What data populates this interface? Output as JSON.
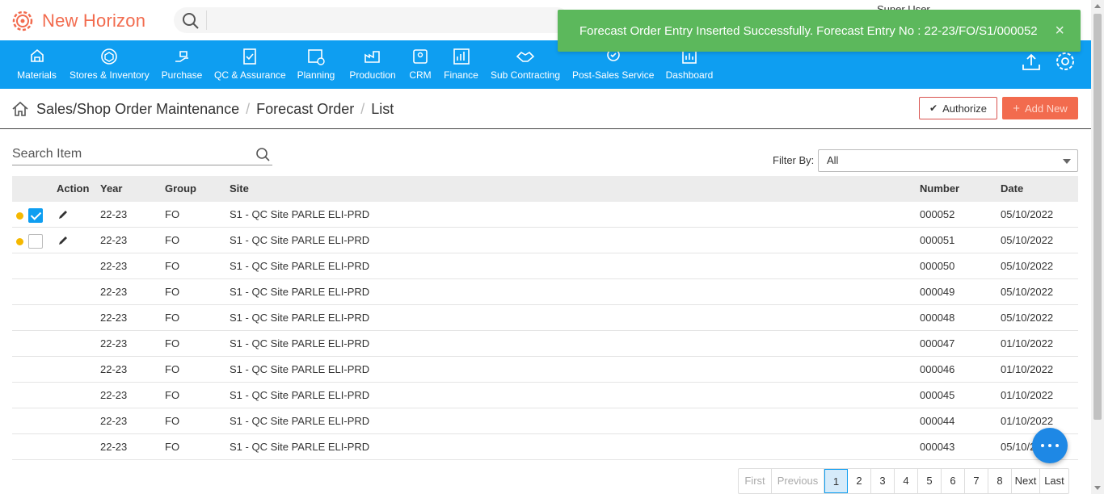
{
  "app": {
    "title": "New Horizon",
    "user": "Super User"
  },
  "topbar": {
    "search_placeholder": ""
  },
  "toast": {
    "message": "Forecast Order Entry Inserted Successfully. Forecast Entry No : 22-23/FO/S1/000052",
    "close": "×"
  },
  "nav": {
    "items": [
      {
        "label": "Materials",
        "icon": "materials-icon"
      },
      {
        "label": "Stores & Inventory",
        "icon": "stores-icon"
      },
      {
        "label": "Purchase",
        "icon": "purchase-icon"
      },
      {
        "label": "QC & Assurance",
        "icon": "qc-icon"
      },
      {
        "label": "Planning",
        "icon": "planning-icon"
      },
      {
        "label": "Production",
        "icon": "production-icon"
      },
      {
        "label": "CRM",
        "icon": "crm-icon"
      },
      {
        "label": "Finance",
        "icon": "finance-icon"
      },
      {
        "label": "Sub Contracting",
        "icon": "handshake-icon"
      },
      {
        "label": "Post-Sales Service",
        "icon": "service-icon"
      },
      {
        "label": "Dashboard",
        "icon": "dashboard-icon"
      }
    ]
  },
  "breadcrumb": {
    "items": [
      "Sales/Shop Order Maintenance",
      "Forecast Order",
      "List"
    ]
  },
  "actions": {
    "authorize": "Authorize",
    "add_new": "Add New"
  },
  "search": {
    "placeholder": "Search Item"
  },
  "filter": {
    "label": "Filter By:",
    "value": "All"
  },
  "table": {
    "headers": {
      "action": "Action",
      "year": "Year",
      "group": "Group",
      "site": "Site",
      "number": "Number",
      "date": "Date"
    },
    "rows": [
      {
        "year": "22-23",
        "group": "FO",
        "site": "S1 - QC Site PARLE ELI-PRD",
        "number": "000052",
        "date": "05/10/2022",
        "checked": true,
        "editable": true
      },
      {
        "year": "22-23",
        "group": "FO",
        "site": "S1 - QC Site PARLE ELI-PRD",
        "number": "000051",
        "date": "05/10/2022",
        "checked": false,
        "editable": true
      },
      {
        "year": "22-23",
        "group": "FO",
        "site": "S1 - QC Site PARLE ELI-PRD",
        "number": "000050",
        "date": "05/10/2022"
      },
      {
        "year": "22-23",
        "group": "FO",
        "site": "S1 - QC Site PARLE ELI-PRD",
        "number": "000049",
        "date": "05/10/2022"
      },
      {
        "year": "22-23",
        "group": "FO",
        "site": "S1 - QC Site PARLE ELI-PRD",
        "number": "000048",
        "date": "05/10/2022"
      },
      {
        "year": "22-23",
        "group": "FO",
        "site": "S1 - QC Site PARLE ELI-PRD",
        "number": "000047",
        "date": "01/10/2022"
      },
      {
        "year": "22-23",
        "group": "FO",
        "site": "S1 - QC Site PARLE ELI-PRD",
        "number": "000046",
        "date": "01/10/2022"
      },
      {
        "year": "22-23",
        "group": "FO",
        "site": "S1 - QC Site PARLE ELI-PRD",
        "number": "000045",
        "date": "01/10/2022"
      },
      {
        "year": "22-23",
        "group": "FO",
        "site": "S1 - QC Site PARLE ELI-PRD",
        "number": "000044",
        "date": "01/10/2022"
      },
      {
        "year": "22-23",
        "group": "FO",
        "site": "S1 - QC Site PARLE ELI-PRD",
        "number": "000043",
        "date": "05/10/2022"
      }
    ]
  },
  "pager": {
    "first": "First",
    "previous": "Previous",
    "pages": [
      "1",
      "2",
      "3",
      "4",
      "5",
      "6",
      "7",
      "8"
    ],
    "current": "1",
    "next": "Next",
    "last": "Last"
  },
  "colors": {
    "brand": "#f26b4e",
    "nav_bg": "#0e9ef1",
    "toast_bg": "#5cb85c",
    "status_dot": "#f5b800"
  }
}
